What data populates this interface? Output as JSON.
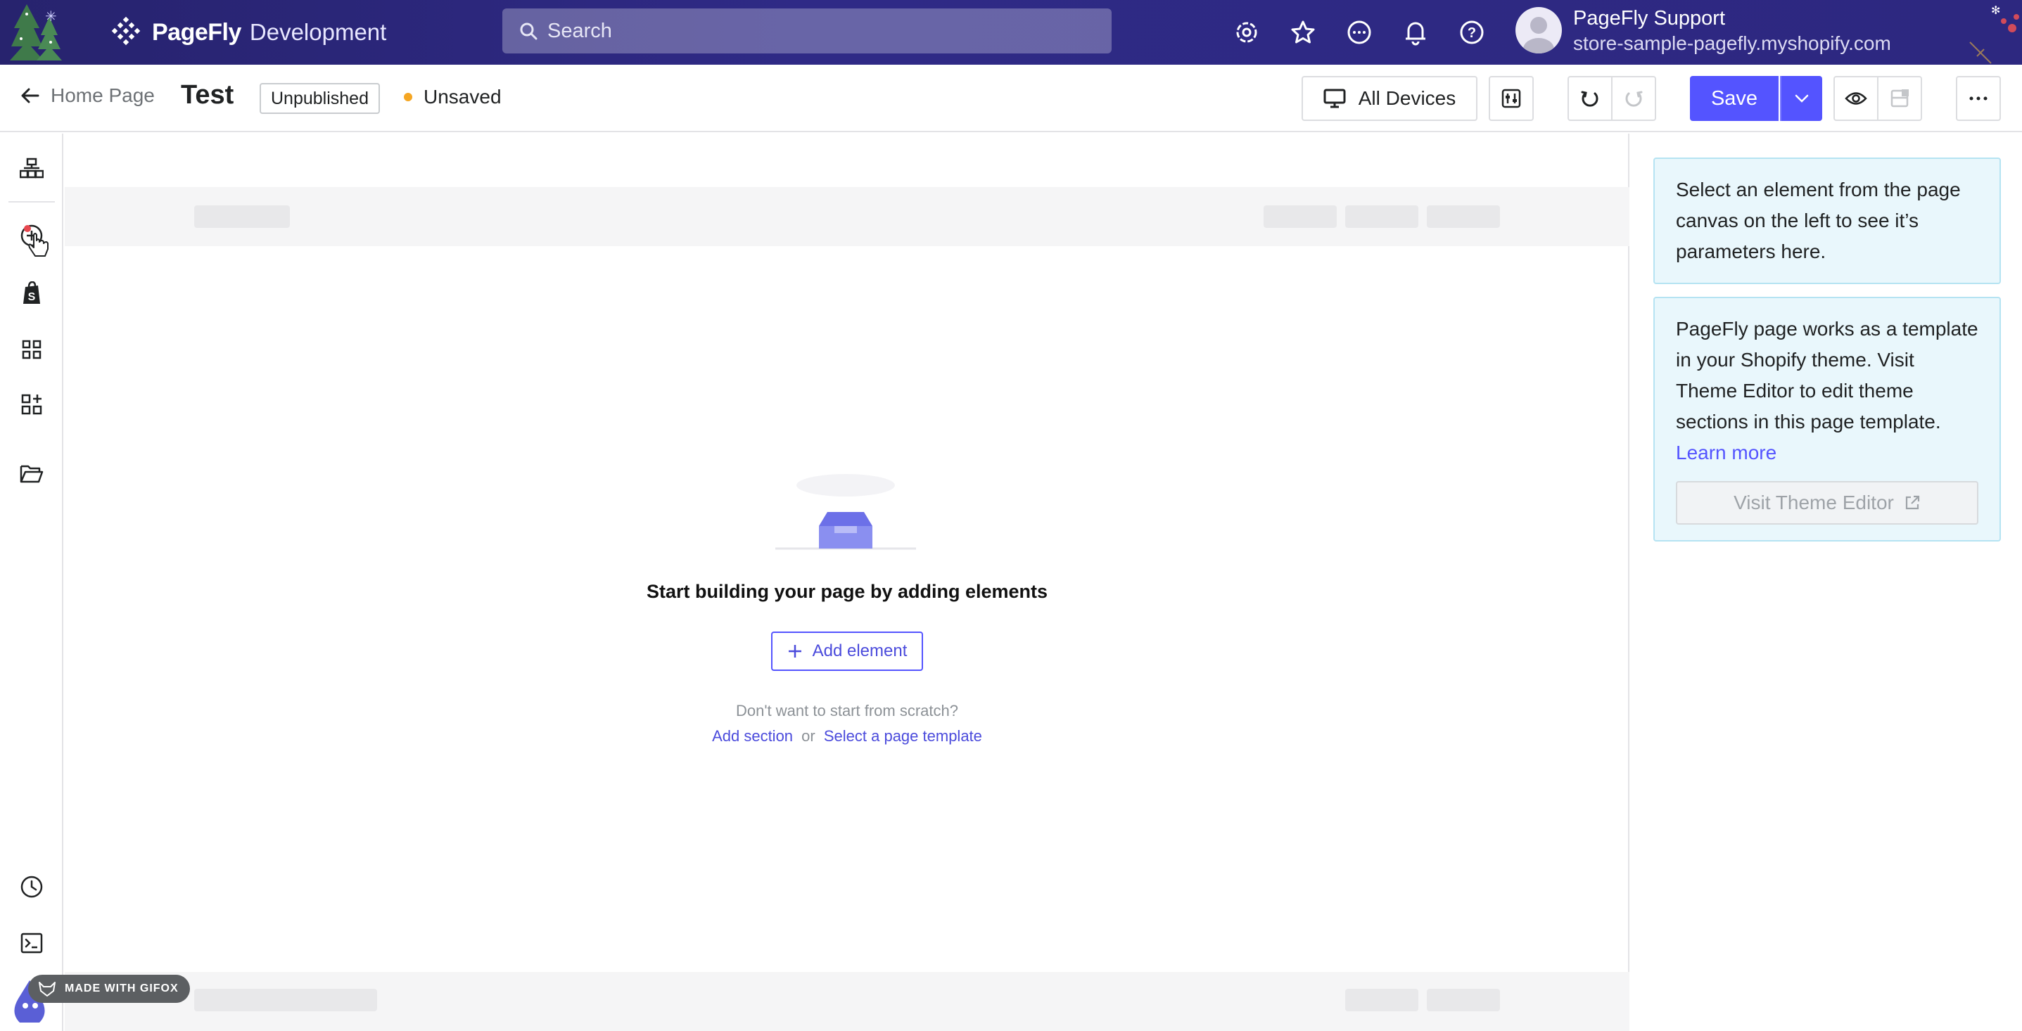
{
  "topbar": {
    "brand_name": "PageFly",
    "brand_env": "Development",
    "search_placeholder": "Search",
    "icons": [
      "settings-icon",
      "star-icon",
      "chat-icon",
      "bell-icon",
      "help-icon"
    ],
    "user_name": "PageFly Support",
    "user_store": "store-sample-pagefly.myshopify.com"
  },
  "subbar": {
    "back_label": "Home Page",
    "page_title": "Test",
    "publish_status": "Unpublished",
    "save_status": "Unsaved",
    "devices_label": "All Devices",
    "save_label": "Save"
  },
  "rail": {
    "icons": [
      "layers-icon",
      "add-element-icon",
      "shopify-icon",
      "grid-icon",
      "grid-add-icon",
      "folder-icon",
      "history-icon",
      "terminal-icon"
    ]
  },
  "canvas": {
    "empty_title": "Start building your page by adding elements",
    "add_element_label": "Add element",
    "hint_text": "Don't want to start from scratch?",
    "add_section_label": "Add section",
    "or_text": "or",
    "template_label": "Select a page template"
  },
  "panel": {
    "select_hint": "Select an element from the page canvas on the left to see it’s parameters here.",
    "theme_info": "PageFly page works as a template in your Shopify theme. Visit Theme Editor to edit theme sections in this page template.",
    "learn_more": "Learn more",
    "visit_theme_editor": "Visit Theme Editor"
  },
  "watermark": {
    "label": "MADE WITH GIFOX"
  },
  "colors": {
    "topbar": "#2d2880",
    "primary": "#5454ff",
    "info_bg": "#e9f7fc",
    "unsaved_dot": "#f5a623"
  }
}
